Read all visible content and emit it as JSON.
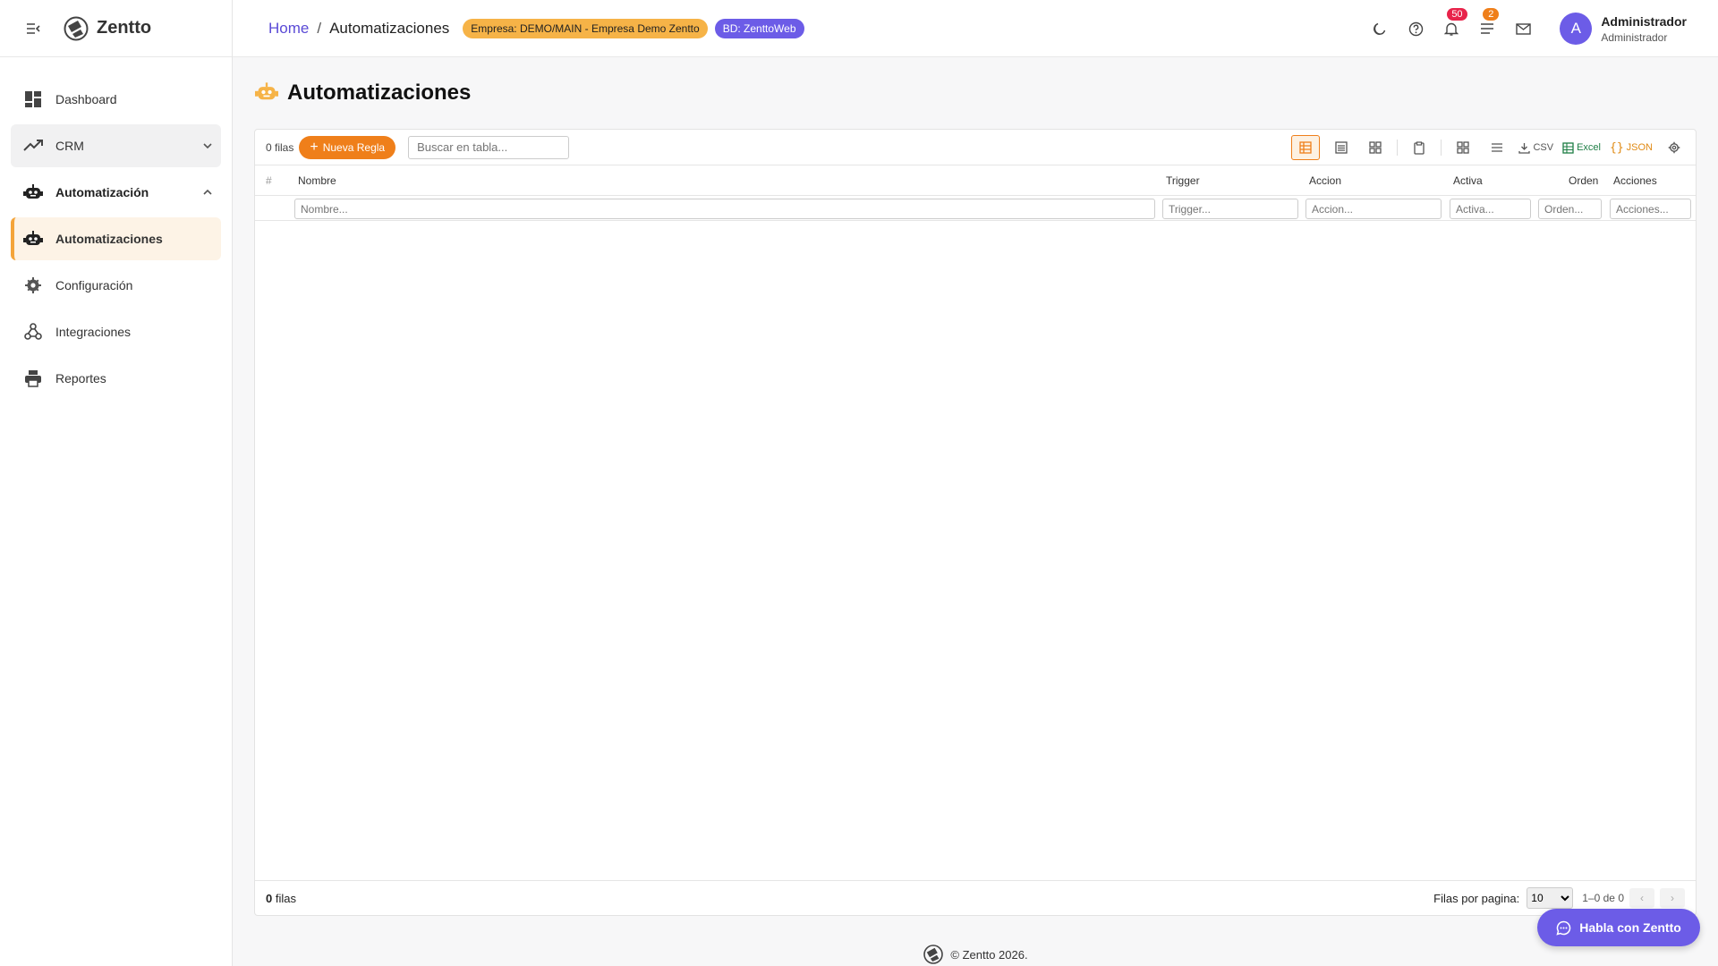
{
  "app": {
    "name": "Zentto"
  },
  "sidebar": {
    "items": [
      {
        "label": "Dashboard"
      },
      {
        "label": "CRM"
      },
      {
        "label": "Automatización"
      },
      {
        "label": "Automatizaciones"
      },
      {
        "label": "Configuración"
      },
      {
        "label": "Integraciones"
      },
      {
        "label": "Reportes"
      }
    ]
  },
  "header": {
    "breadcrumb_home": "Home",
    "breadcrumb_sep": "/",
    "breadcrumb_current": "Automatizaciones",
    "company_badge": "Empresa: DEMO/MAIN - Empresa Demo Zentto",
    "db_badge": "BD: ZenttoWeb",
    "notifications_count": "50",
    "tasks_count": "2",
    "user_initial": "A",
    "user_name": "Administrador",
    "user_role": "Administrador"
  },
  "page": {
    "title": "Automatizaciones"
  },
  "table": {
    "rows_label": "0 filas",
    "new_button": "Nueva Regla",
    "search_placeholder": "Buscar en tabla...",
    "export_csv": "CSV",
    "export_excel": "Excel",
    "export_json": "JSON",
    "columns": [
      "#",
      "Nombre",
      "Trigger",
      "Accion",
      "Activa",
      "Orden",
      "Acciones"
    ],
    "filter_placeholders": {
      "nombre": "Nombre...",
      "trigger": "Trigger...",
      "accion": "Accion...",
      "activa": "Activa...",
      "orden": "Orden...",
      "acciones": "Acciones..."
    },
    "footer_count": "0",
    "footer_label": "filas",
    "rows_per_page_label": "Filas por pagina:",
    "rows_per_page": "10",
    "range": "1–0 de 0",
    "prev": "‹",
    "next": "›"
  },
  "footer": {
    "text": "© Zentto 2026."
  },
  "chat": {
    "label": "Habla con Zentto"
  },
  "colors": {
    "accent": "#ef7f1a",
    "brand": "#6c5ce7",
    "badge_company": "#f6b347",
    "active_bg": "#fdf3e6"
  }
}
